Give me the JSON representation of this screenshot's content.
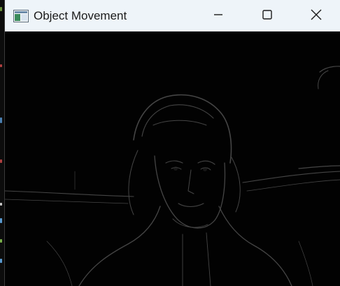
{
  "window": {
    "title": "Object Movement",
    "app_icon": "window-icon",
    "controls": {
      "minimize_icon": "minimize-icon",
      "maximize_icon": "maximize-icon",
      "close_icon": "close-icon"
    }
  },
  "content": {
    "type": "video-feed",
    "description_icon": "edge-detection-frame"
  },
  "colors": {
    "titlebar": "#eef4f9",
    "title_text": "#1b1b1b",
    "feed_background": "#020202",
    "feed_edges": "#6a6a6a"
  }
}
